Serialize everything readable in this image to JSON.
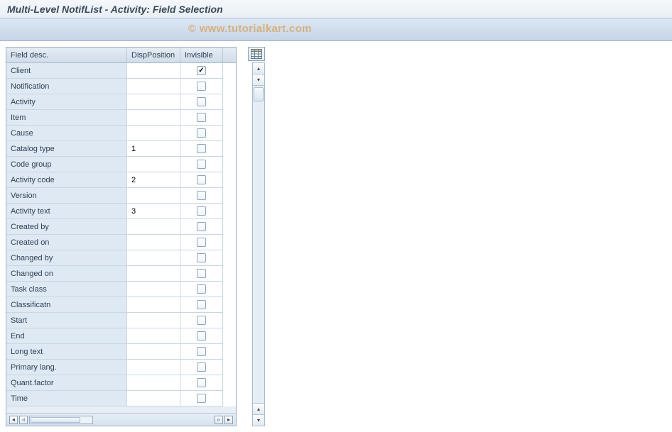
{
  "title": "Multi-Level NotifList - Activity: Field Selection",
  "watermark": "© www.tutorialkart.com",
  "grid": {
    "columns": {
      "desc": "Field desc.",
      "pos": "DispPosition",
      "inv": "Invisible"
    },
    "rows": [
      {
        "desc": "Client",
        "pos": "",
        "inv": true
      },
      {
        "desc": "Notification",
        "pos": "",
        "inv": false
      },
      {
        "desc": "Activity",
        "pos": "",
        "inv": false
      },
      {
        "desc": "Item",
        "pos": "",
        "inv": false
      },
      {
        "desc": "Cause",
        "pos": "",
        "inv": false
      },
      {
        "desc": "Catalog type",
        "pos": "1",
        "inv": false
      },
      {
        "desc": "Code group",
        "pos": "",
        "inv": false
      },
      {
        "desc": "Activity code",
        "pos": "2",
        "inv": false
      },
      {
        "desc": "Version",
        "pos": "",
        "inv": false
      },
      {
        "desc": "Activity text",
        "pos": "3",
        "inv": false
      },
      {
        "desc": "Created by",
        "pos": "",
        "inv": false
      },
      {
        "desc": "Created on",
        "pos": "",
        "inv": false
      },
      {
        "desc": "Changed by",
        "pos": "",
        "inv": false
      },
      {
        "desc": "Changed on",
        "pos": "",
        "inv": false
      },
      {
        "desc": "Task class",
        "pos": "",
        "inv": false
      },
      {
        "desc": "Classificatn",
        "pos": "",
        "inv": false
      },
      {
        "desc": "Start",
        "pos": "",
        "inv": false
      },
      {
        "desc": "End",
        "pos": "",
        "inv": false
      },
      {
        "desc": "Long text",
        "pos": "",
        "inv": false
      },
      {
        "desc": "Primary lang.",
        "pos": "",
        "inv": false
      },
      {
        "desc": "Quant.factor",
        "pos": "",
        "inv": false
      },
      {
        "desc": "Time",
        "pos": "",
        "inv": false
      }
    ]
  }
}
